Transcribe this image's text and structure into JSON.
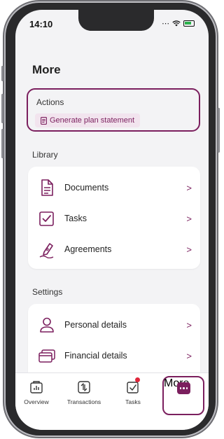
{
  "status": {
    "time": "14:10"
  },
  "page": {
    "title": "More"
  },
  "actions": {
    "label": "Actions",
    "generate_label": "Generate plan statement"
  },
  "library": {
    "label": "Library",
    "items": [
      {
        "label": "Documents",
        "icon": "document-icon"
      },
      {
        "label": "Tasks",
        "icon": "checkbox-icon"
      },
      {
        "label": "Agreements",
        "icon": "signature-pen-icon"
      }
    ]
  },
  "settings": {
    "label": "Settings",
    "items": [
      {
        "label": "Personal details",
        "icon": "person-icon"
      },
      {
        "label": "Financial details",
        "icon": "cards-icon"
      }
    ]
  },
  "tabbar": {
    "tabs": [
      {
        "label": "Overview",
        "icon": "chart-icon"
      },
      {
        "label": "Transactions",
        "icon": "transfer-icon"
      },
      {
        "label": "Tasks",
        "icon": "task-check-icon"
      },
      {
        "label": "More",
        "icon": "more-dots-icon",
        "active": true
      }
    ]
  },
  "colors": {
    "accent": "#7b1f5e",
    "accent_light": "#f2e4ee",
    "notification": "#e0263b"
  }
}
